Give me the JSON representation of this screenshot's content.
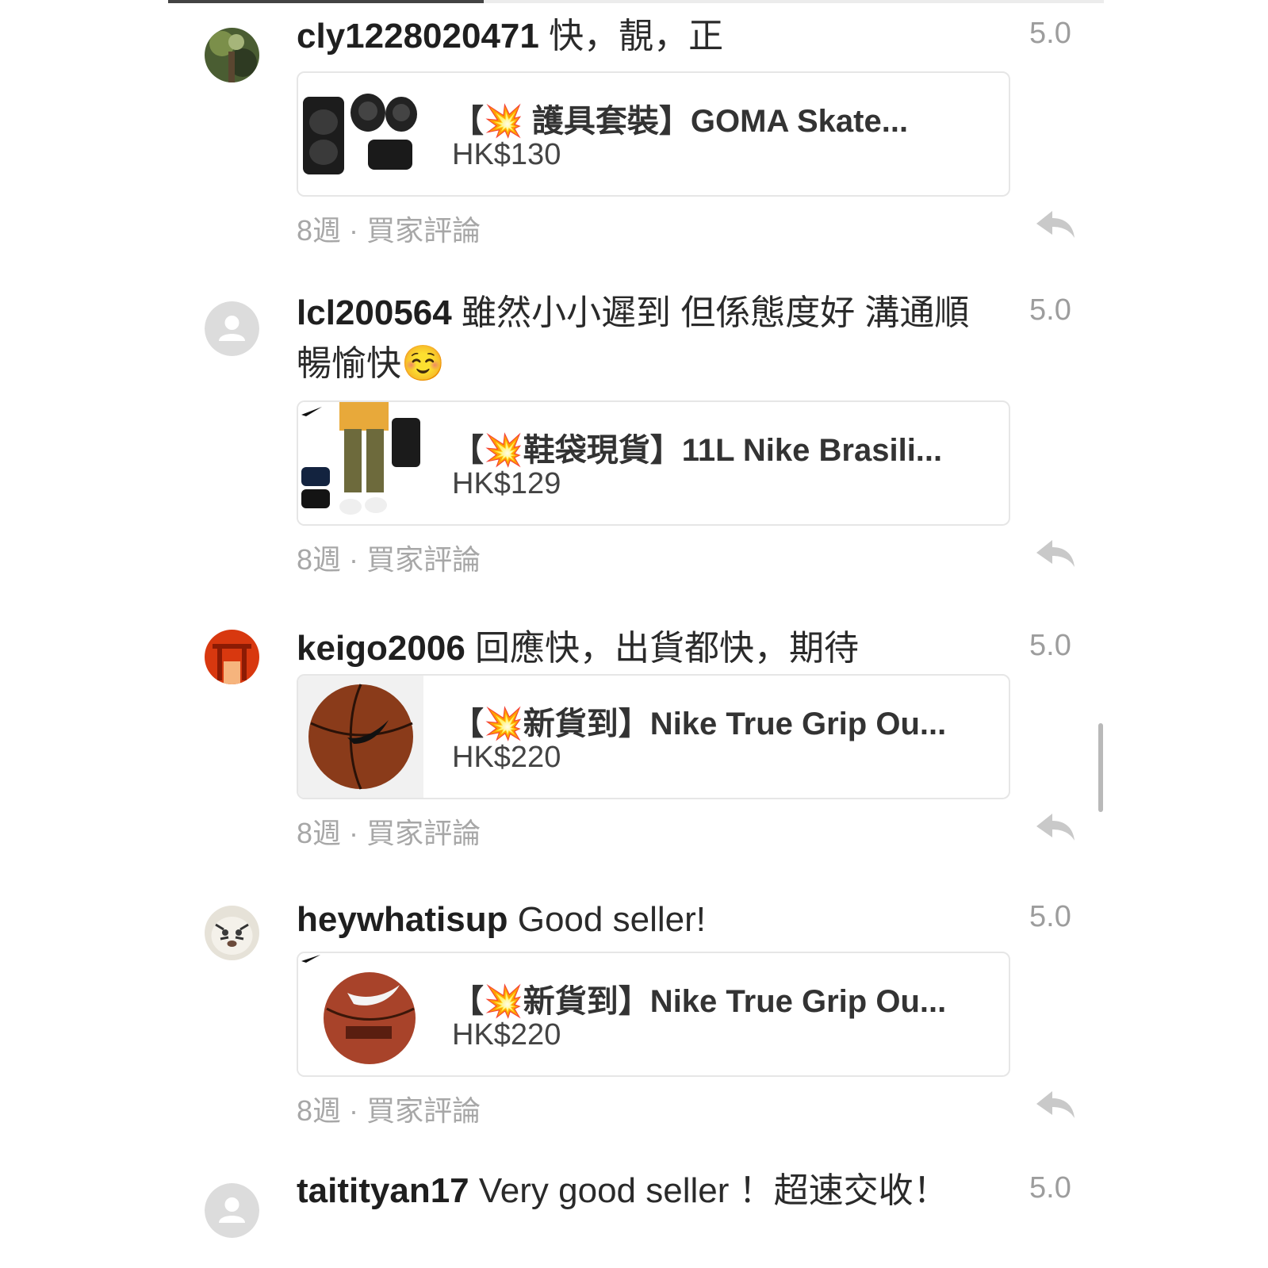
{
  "reviews": [
    {
      "username": "cly1228020471",
      "comment": "快，靚，正",
      "rating": "5.0",
      "avatar": "photo-avatar",
      "product": {
        "title": "【💥 護具套裝】GOMA Skate...",
        "price": "HK$130",
        "thumb": "skate-pads"
      },
      "time": "8週",
      "type": "買家評論"
    },
    {
      "username": "lcl200564",
      "comment": "雖然小小遲到 但係態度好 溝通順暢愉快☺️",
      "rating": "5.0",
      "avatar": "default-avatar",
      "product": {
        "title": "【💥鞋袋現貨】11L Nike Brasili...",
        "price": "HK$129",
        "thumb": "shoe-bag"
      },
      "time": "8週",
      "type": "買家評論"
    },
    {
      "username": "keigo2006",
      "comment": "回應快，出貨都快，期待",
      "rating": "5.0",
      "avatar": "torii-avatar",
      "product": {
        "title": "【💥新貨到】Nike True Grip Ou...",
        "price": "HK$220",
        "thumb": "basketball"
      },
      "time": "8週",
      "type": "買家評論"
    },
    {
      "username": "heywhatisup",
      "comment": "Good seller!",
      "rating": "5.0",
      "avatar": "tiger-avatar",
      "product": {
        "title": "【💥新貨到】Nike True Grip Ou...",
        "price": "HK$220",
        "thumb": "basketball-grip"
      },
      "time": "8週",
      "type": "買家評論"
    },
    {
      "username": "taitityan17",
      "comment": "Very good seller ！超速交收！",
      "rating": "5.0",
      "avatar": "default-avatar"
    }
  ],
  "meta_separator": "·"
}
